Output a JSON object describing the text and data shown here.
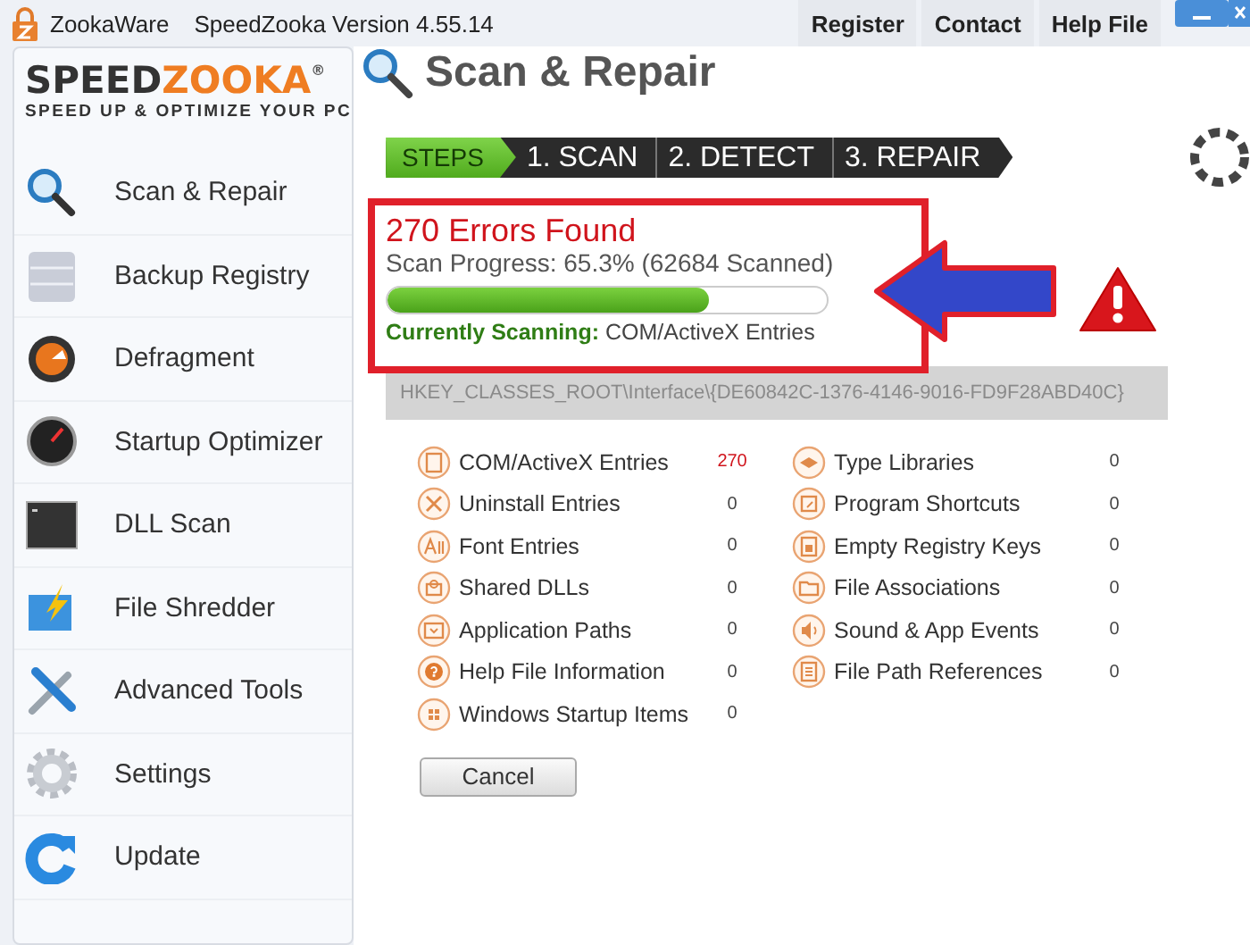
{
  "title_bar": {
    "brand": "ZookaWare",
    "title": "SpeedZooka Version 4.55.14",
    "menu": [
      "Register",
      "Contact",
      "Help File"
    ]
  },
  "logo": {
    "part_dark": "SPEED",
    "part_orange": "ZOOKA",
    "mark": "®",
    "tagline": "SPEED UP & OPTIMIZE YOUR PC"
  },
  "sidebar": {
    "items": [
      {
        "label": "Scan & Repair"
      },
      {
        "label": "Backup Registry"
      },
      {
        "label": "Defragment"
      },
      {
        "label": "Startup Optimizer"
      },
      {
        "label": "DLL Scan"
      },
      {
        "label": "File Shredder"
      },
      {
        "label": "Advanced Tools"
      },
      {
        "label": "Settings"
      },
      {
        "label": "Update"
      }
    ]
  },
  "page_title": "Scan & Repair",
  "steps": [
    {
      "label": "STEPS",
      "kind": "label"
    },
    {
      "label": "1. SCAN",
      "kind": "step"
    },
    {
      "label": "2. DETECT",
      "kind": "step"
    },
    {
      "label": "3. REPAIR",
      "kind": "step"
    }
  ],
  "status": {
    "errors": "270 Errors Found",
    "progress_text": "Scan Progress: 65.3% (62684 Scanned)",
    "level": 0.73,
    "scanning_label": "Currently Scanning:",
    "scanning_value": "COM/ActiveX Entries"
  },
  "registry_path": "HKEY_CLASSES_ROOT\\Interface\\{DE60842C-1376-4146-9016-FD9F28ABD40C}",
  "category_columns": [
    {
      "items": [
        {
          "label": "COM/ActiveX Entries",
          "count": "270",
          "has_errors": true
        },
        {
          "label": "Uninstall Entries",
          "count": "0",
          "has_errors": false
        },
        {
          "label": "Font Entries",
          "count": "0",
          "has_errors": false
        },
        {
          "label": "Shared DLLs",
          "count": "0",
          "has_errors": false
        },
        {
          "label": "Application Paths",
          "count": "0",
          "has_errors": false
        },
        {
          "label": "Help File Information",
          "count": "0",
          "has_errors": false
        },
        {
          "label": "Windows Startup Items",
          "count": "0",
          "has_errors": false
        }
      ]
    },
    {
      "items": [
        {
          "label": "Type Libraries",
          "count": "0",
          "has_errors": false
        },
        {
          "label": "Program Shortcuts",
          "count": "0",
          "has_errors": false
        },
        {
          "label": "Empty Registry Keys",
          "count": "0",
          "has_errors": false
        },
        {
          "label": "File Associations",
          "count": "0",
          "has_errors": false
        },
        {
          "label": "Sound & App Events",
          "count": "0",
          "has_errors": false
        },
        {
          "label": "File Path References",
          "count": "0",
          "has_errors": false
        }
      ]
    }
  ],
  "cancel_button": "Cancel"
}
